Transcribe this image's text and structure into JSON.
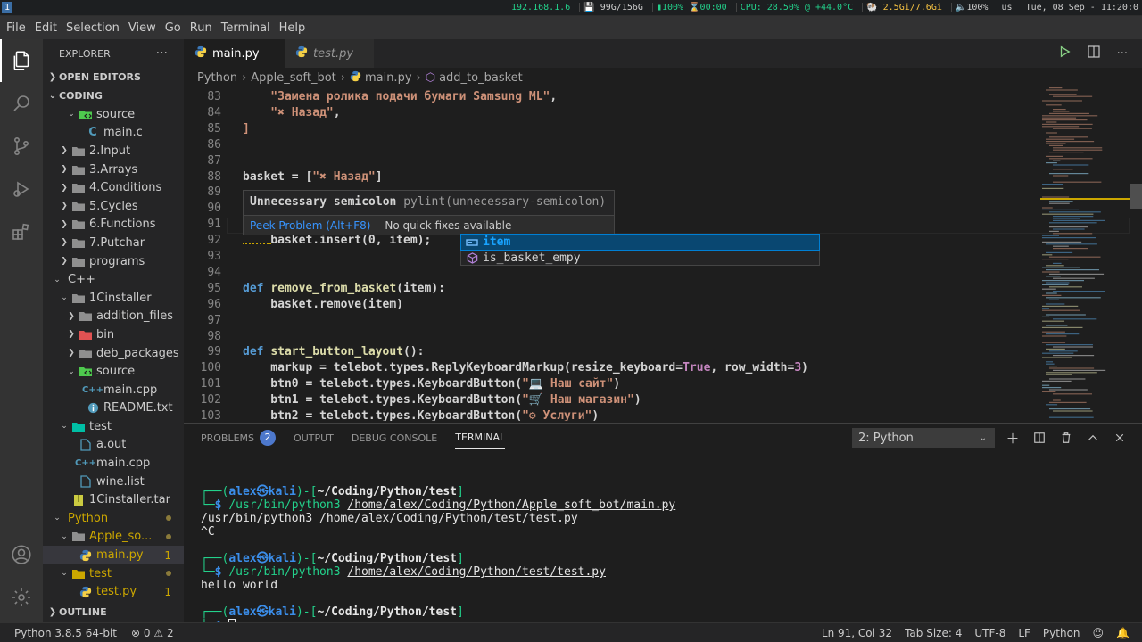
{
  "system_bar": {
    "workspace": "1",
    "ip": "192.168.1.6",
    "disk": "99G/156G",
    "battery": "100%",
    "timer": "00:00",
    "cpu": "CPU: 28.50% @ +44.0°C",
    "mem": "2.5Gi/7.6Gi",
    "volume": "100%",
    "layout": "us",
    "datetime": "Tue, 08 Sep - 11:20:0"
  },
  "menu": [
    "File",
    "Edit",
    "Selection",
    "View",
    "Go",
    "Run",
    "Terminal",
    "Help"
  ],
  "activity_icons": [
    "explorer-icon",
    "search-icon",
    "source-control-icon",
    "run-icon",
    "extensions-icon",
    "accounts-icon",
    "settings-gear-icon"
  ],
  "sidebar": {
    "title": "EXPLORER",
    "more": "···",
    "open_editors": "OPEN EDITORS",
    "coding": "CODING",
    "outline": "OUTLINE",
    "tree": [
      {
        "label": "source",
        "indent": 3,
        "chev": "v",
        "icon": "folder-src",
        "color": "#4ec94e"
      },
      {
        "label": "main.c",
        "indent": 4,
        "chev": "",
        "icon": "c",
        "color": "#519aba"
      },
      {
        "label": "2.Input",
        "indent": 2,
        "chev": ">",
        "icon": "folder",
        "color": "#c5c5c5"
      },
      {
        "label": "3.Arrays",
        "indent": 2,
        "chev": ">",
        "icon": "folder",
        "color": "#c5c5c5"
      },
      {
        "label": "4.Conditions",
        "indent": 2,
        "chev": ">",
        "icon": "folder",
        "color": "#c5c5c5"
      },
      {
        "label": "5.Cycles",
        "indent": 2,
        "chev": ">",
        "icon": "folder",
        "color": "#c5c5c5"
      },
      {
        "label": "6.Functions",
        "indent": 2,
        "chev": ">",
        "icon": "folder",
        "color": "#c5c5c5"
      },
      {
        "label": "7.Putchar",
        "indent": 2,
        "chev": ">",
        "icon": "folder",
        "color": "#c5c5c5"
      },
      {
        "label": "programs",
        "indent": 2,
        "chev": ">",
        "icon": "folder",
        "color": "#c5c5c5"
      },
      {
        "label": "C++",
        "indent": 1,
        "chev": "v",
        "icon": "none",
        "color": "#c5c5c5"
      },
      {
        "label": "1Cinstaller",
        "indent": 2,
        "chev": "v",
        "icon": "folder",
        "color": "#c5c5c5"
      },
      {
        "label": "addition_files",
        "indent": 3,
        "chev": ">",
        "icon": "folder",
        "color": "#c5c5c5"
      },
      {
        "label": "bin",
        "indent": 3,
        "chev": ">",
        "icon": "folder-bin",
        "color": "#e05252"
      },
      {
        "label": "deb_packages",
        "indent": 3,
        "chev": ">",
        "icon": "folder",
        "color": "#c5c5c5"
      },
      {
        "label": "source",
        "indent": 3,
        "chev": "v",
        "icon": "folder-src",
        "color": "#4ec94e"
      },
      {
        "label": "main.cpp",
        "indent": 4,
        "chev": "",
        "icon": "cpp",
        "color": "#519aba"
      },
      {
        "label": "README.txt",
        "indent": 4,
        "chev": "",
        "icon": "info",
        "color": "#519aba"
      },
      {
        "label": "test",
        "indent": 2,
        "chev": "v",
        "icon": "folder-test",
        "color": "#00bfa5"
      },
      {
        "label": "a.out",
        "indent": 3,
        "chev": "",
        "icon": "file",
        "color": "#519aba"
      },
      {
        "label": "main.cpp",
        "indent": 3,
        "chev": "",
        "icon": "cpp",
        "color": "#519aba"
      },
      {
        "label": "wine.list",
        "indent": 3,
        "chev": "",
        "icon": "file",
        "color": "#519aba"
      },
      {
        "label": "1Cinstaller.tar",
        "indent": 2,
        "chev": "",
        "icon": "archive",
        "color": "#cbcb41"
      },
      {
        "label": "Python",
        "indent": 1,
        "chev": "v",
        "icon": "none",
        "color": "#cca700",
        "mod": true,
        "dot": true
      },
      {
        "label": "Apple_so...",
        "indent": 2,
        "chev": "v",
        "icon": "folder",
        "color": "#cca700",
        "mod": true,
        "dot": true
      },
      {
        "label": "main.py",
        "indent": 3,
        "chev": "",
        "icon": "python",
        "color": "#3572a5",
        "mod": true,
        "badge": "1",
        "selected": true
      },
      {
        "label": "test",
        "indent": 2,
        "chev": "v",
        "icon": "folder-test",
        "color": "#cca700",
        "mod": true,
        "dot": true
      },
      {
        "label": "test.py",
        "indent": 3,
        "chev": "",
        "icon": "python",
        "color": "#3572a5",
        "mod": true,
        "badge": "1"
      }
    ]
  },
  "tabs": [
    {
      "label": "main.py",
      "active": true
    },
    {
      "label": "test.py",
      "active": false
    }
  ],
  "breadcrumb": [
    "Python",
    "Apple_soft_bot",
    "main.py",
    "add_to_basket"
  ],
  "code_lines": [
    {
      "n": "83",
      "tokens": [
        {
          "t": "    \"Замена ролика подачи бумаги Samsung ML\"",
          "c": "str"
        },
        {
          "t": ",",
          "c": "plain"
        }
      ]
    },
    {
      "n": "84",
      "tokens": [
        {
          "t": "    \"✖ Назад\"",
          "c": "str"
        },
        {
          "t": ",",
          "c": "plain"
        }
      ]
    },
    {
      "n": "85",
      "tokens": [
        {
          "t": "]",
          "c": "str"
        }
      ]
    },
    {
      "n": "86",
      "tokens": []
    },
    {
      "n": "87",
      "tokens": []
    },
    {
      "n": "88",
      "tokens": [
        {
          "t": "basket = [",
          "c": "plain"
        },
        {
          "t": "\"✖ Назад\"",
          "c": "str"
        },
        {
          "t": "]",
          "c": "plain"
        }
      ]
    },
    {
      "n": "89",
      "tokens": []
    },
    {
      "n": "90",
      "tokens": []
    },
    {
      "n": "91",
      "tokens": []
    },
    {
      "n": "92",
      "tokens": [
        {
          "t": "    basket.insert(0, item);",
          "c": "plain"
        }
      ]
    },
    {
      "n": "93",
      "tokens": []
    },
    {
      "n": "94",
      "tokens": []
    },
    {
      "n": "95",
      "tokens": [
        {
          "t": "def ",
          "c": "kw"
        },
        {
          "t": "remove_from_basket",
          "c": "fn"
        },
        {
          "t": "(item):",
          "c": "plain"
        }
      ]
    },
    {
      "n": "96",
      "tokens": [
        {
          "t": "    basket.remove(item)",
          "c": "plain"
        }
      ]
    },
    {
      "n": "97",
      "tokens": []
    },
    {
      "n": "98",
      "tokens": []
    },
    {
      "n": "99",
      "tokens": [
        {
          "t": "def ",
          "c": "kw"
        },
        {
          "t": "start_button_layout",
          "c": "fn"
        },
        {
          "t": "():",
          "c": "plain"
        }
      ]
    },
    {
      "n": "100",
      "tokens": [
        {
          "t": "    markup = telebot.types.ReplyKeyboardMarkup(resize_keyboard=",
          "c": "plain"
        },
        {
          "t": "True",
          "c": "pink"
        },
        {
          "t": ", row_width=",
          "c": "plain"
        },
        {
          "t": "3",
          "c": "pink"
        },
        {
          "t": ")",
          "c": "plain"
        }
      ]
    },
    {
      "n": "101",
      "tokens": [
        {
          "t": "    btn0 = telebot.types.KeyboardButton(",
          "c": "plain"
        },
        {
          "t": "\"💻 Наш сайт\"",
          "c": "str"
        },
        {
          "t": ")",
          "c": "plain"
        }
      ]
    },
    {
      "n": "102",
      "tokens": [
        {
          "t": "    btn1 = telebot.types.KeyboardButton(",
          "c": "plain"
        },
        {
          "t": "\"🛒 Наш магазин\"",
          "c": "str"
        },
        {
          "t": ")",
          "c": "plain"
        }
      ]
    },
    {
      "n": "103",
      "tokens": [
        {
          "t": "    btn2 = telebot.types.KeyboardButton(",
          "c": "plain"
        },
        {
          "t": "\"⚙ Услуги\"",
          "c": "str"
        },
        {
          "t": ")",
          "c": "plain"
        }
      ]
    }
  ],
  "hover": {
    "message": "Unnecessary semicolon",
    "source": "pylint(unnecessary-semicolon)",
    "peek": "Peek Problem (Alt+F8)",
    "no_fix": "No quick fixes available"
  },
  "suggestions": [
    {
      "label": "item",
      "match": "",
      "rest": "item",
      "icon": "variable-icon",
      "selected": true
    },
    {
      "label": "is_basket_empy",
      "match": "",
      "rest": "is_basket_empy",
      "icon": "function-icon",
      "selected": false
    }
  ],
  "panel": {
    "tabs": [
      {
        "label": "PROBLEMS",
        "count": "2"
      },
      {
        "label": "OUTPUT"
      },
      {
        "label": "DEBUG CONSOLE"
      },
      {
        "label": "TERMINAL",
        "active": true
      }
    ],
    "terminal_select": "2: Python"
  },
  "terminal": [
    {
      "type": "blank"
    },
    {
      "type": "prompt",
      "user": "alex",
      "host": "kali",
      "path": "~/Coding/Python/test"
    },
    {
      "type": "cmd",
      "cmd": "/usr/bin/python3",
      "arg": "/home/alex/Coding/Python/Apple_soft_bot/main.py"
    },
    {
      "type": "out",
      "text": "/usr/bin/python3 /home/alex/Coding/Python/test/test.py"
    },
    {
      "type": "out",
      "text": "^C"
    },
    {
      "type": "blank"
    },
    {
      "type": "prompt",
      "user": "alex",
      "host": "kali",
      "path": "~/Coding/Python/test"
    },
    {
      "type": "cmd",
      "cmd": "/usr/bin/python3",
      "arg": "/home/alex/Coding/Python/test/test.py"
    },
    {
      "type": "out",
      "text": "hello world"
    },
    {
      "type": "blank"
    },
    {
      "type": "prompt",
      "user": "alex",
      "host": "kali",
      "path": "~/Coding/Python/test"
    },
    {
      "type": "cursor"
    }
  ],
  "status": {
    "interpreter": "Python 3.8.5 64-bit",
    "errors": "0",
    "warnings": "2",
    "position": "Ln 91, Col 32",
    "tabsize": "Tab Size: 4",
    "encoding": "UTF-8",
    "eol": "LF",
    "language": "Python"
  }
}
